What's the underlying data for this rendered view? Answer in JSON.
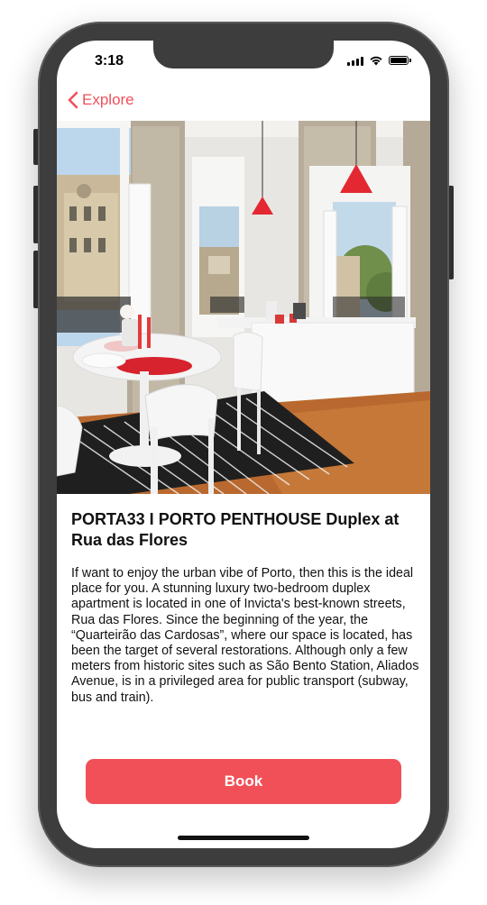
{
  "status_bar": {
    "time": "3:18",
    "icons": [
      "signal-icon",
      "wifi-icon",
      "battery-icon"
    ]
  },
  "nav": {
    "back_label": "Explore",
    "back_icon": "chevron-left-icon"
  },
  "listing": {
    "title": "PORTA33 I PORTO PENTHOUSE Duplex at Rua das Flores",
    "description": "  If want to enjoy the urban vibe of Porto, then this is the ideal place for you. A stunning luxury two-bedroom duplex apartment is located in one of Invicta's best-known streets, Rua das Flores. Since the beginning of the year, the “Quarteirão das Cardosas”, where our space is located, has been the target of several restorations. Although only a few meters from historic sites such as São Bento Station, Aliados Avenue, is in a privileged area for public transport (subway, bus and train)."
  },
  "actions": {
    "book_label": "Book"
  },
  "colors": {
    "accent": "#f0505a",
    "button": "#f25058",
    "frame": "#3d3d3d"
  }
}
